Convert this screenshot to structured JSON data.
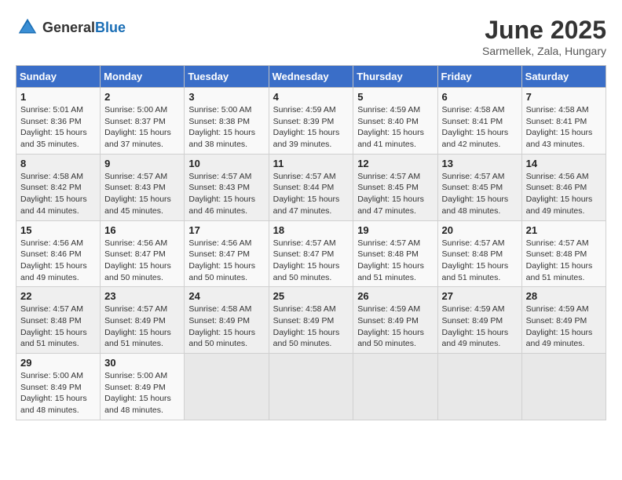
{
  "header": {
    "logo_general": "General",
    "logo_blue": "Blue",
    "title": "June 2025",
    "location": "Sarmellek, Zala, Hungary"
  },
  "days_of_week": [
    "Sunday",
    "Monday",
    "Tuesday",
    "Wednesday",
    "Thursday",
    "Friday",
    "Saturday"
  ],
  "weeks": [
    [
      {
        "day": "1",
        "sunrise": "5:01 AM",
        "sunset": "8:36 PM",
        "daylight": "15 hours and 35 minutes."
      },
      {
        "day": "2",
        "sunrise": "5:00 AM",
        "sunset": "8:37 PM",
        "daylight": "15 hours and 37 minutes."
      },
      {
        "day": "3",
        "sunrise": "5:00 AM",
        "sunset": "8:38 PM",
        "daylight": "15 hours and 38 minutes."
      },
      {
        "day": "4",
        "sunrise": "4:59 AM",
        "sunset": "8:39 PM",
        "daylight": "15 hours and 39 minutes."
      },
      {
        "day": "5",
        "sunrise": "4:59 AM",
        "sunset": "8:40 PM",
        "daylight": "15 hours and 41 minutes."
      },
      {
        "day": "6",
        "sunrise": "4:58 AM",
        "sunset": "8:41 PM",
        "daylight": "15 hours and 42 minutes."
      },
      {
        "day": "7",
        "sunrise": "4:58 AM",
        "sunset": "8:41 PM",
        "daylight": "15 hours and 43 minutes."
      }
    ],
    [
      {
        "day": "8",
        "sunrise": "4:58 AM",
        "sunset": "8:42 PM",
        "daylight": "15 hours and 44 minutes."
      },
      {
        "day": "9",
        "sunrise": "4:57 AM",
        "sunset": "8:43 PM",
        "daylight": "15 hours and 45 minutes."
      },
      {
        "day": "10",
        "sunrise": "4:57 AM",
        "sunset": "8:43 PM",
        "daylight": "15 hours and 46 minutes."
      },
      {
        "day": "11",
        "sunrise": "4:57 AM",
        "sunset": "8:44 PM",
        "daylight": "15 hours and 47 minutes."
      },
      {
        "day": "12",
        "sunrise": "4:57 AM",
        "sunset": "8:45 PM",
        "daylight": "15 hours and 47 minutes."
      },
      {
        "day": "13",
        "sunrise": "4:57 AM",
        "sunset": "8:45 PM",
        "daylight": "15 hours and 48 minutes."
      },
      {
        "day": "14",
        "sunrise": "4:56 AM",
        "sunset": "8:46 PM",
        "daylight": "15 hours and 49 minutes."
      }
    ],
    [
      {
        "day": "15",
        "sunrise": "4:56 AM",
        "sunset": "8:46 PM",
        "daylight": "15 hours and 49 minutes."
      },
      {
        "day": "16",
        "sunrise": "4:56 AM",
        "sunset": "8:47 PM",
        "daylight": "15 hours and 50 minutes."
      },
      {
        "day": "17",
        "sunrise": "4:56 AM",
        "sunset": "8:47 PM",
        "daylight": "15 hours and 50 minutes."
      },
      {
        "day": "18",
        "sunrise": "4:57 AM",
        "sunset": "8:47 PM",
        "daylight": "15 hours and 50 minutes."
      },
      {
        "day": "19",
        "sunrise": "4:57 AM",
        "sunset": "8:48 PM",
        "daylight": "15 hours and 51 minutes."
      },
      {
        "day": "20",
        "sunrise": "4:57 AM",
        "sunset": "8:48 PM",
        "daylight": "15 hours and 51 minutes."
      },
      {
        "day": "21",
        "sunrise": "4:57 AM",
        "sunset": "8:48 PM",
        "daylight": "15 hours and 51 minutes."
      }
    ],
    [
      {
        "day": "22",
        "sunrise": "4:57 AM",
        "sunset": "8:48 PM",
        "daylight": "15 hours and 51 minutes."
      },
      {
        "day": "23",
        "sunrise": "4:57 AM",
        "sunset": "8:49 PM",
        "daylight": "15 hours and 51 minutes."
      },
      {
        "day": "24",
        "sunrise": "4:58 AM",
        "sunset": "8:49 PM",
        "daylight": "15 hours and 50 minutes."
      },
      {
        "day": "25",
        "sunrise": "4:58 AM",
        "sunset": "8:49 PM",
        "daylight": "15 hours and 50 minutes."
      },
      {
        "day": "26",
        "sunrise": "4:59 AM",
        "sunset": "8:49 PM",
        "daylight": "15 hours and 50 minutes."
      },
      {
        "day": "27",
        "sunrise": "4:59 AM",
        "sunset": "8:49 PM",
        "daylight": "15 hours and 49 minutes."
      },
      {
        "day": "28",
        "sunrise": "4:59 AM",
        "sunset": "8:49 PM",
        "daylight": "15 hours and 49 minutes."
      }
    ],
    [
      {
        "day": "29",
        "sunrise": "5:00 AM",
        "sunset": "8:49 PM",
        "daylight": "15 hours and 48 minutes."
      },
      {
        "day": "30",
        "sunrise": "5:00 AM",
        "sunset": "8:49 PM",
        "daylight": "15 hours and 48 minutes."
      },
      null,
      null,
      null,
      null,
      null
    ]
  ]
}
